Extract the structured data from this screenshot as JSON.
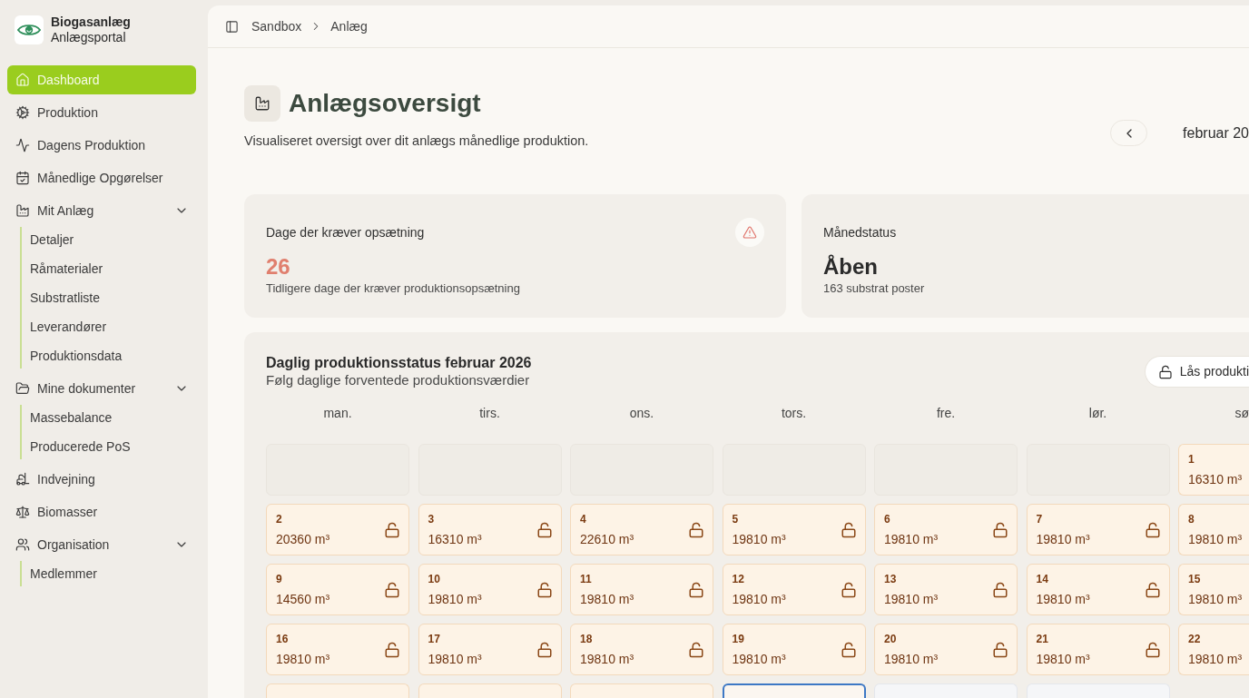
{
  "sidebar": {
    "brand": {
      "title": "Biogasanlæg",
      "subtitle": "Anlægsportal"
    },
    "items": [
      {
        "label": "Dashboard",
        "selected": true
      },
      {
        "label": "Produktion",
        "selected": false
      },
      {
        "label": "Dagens Produktion",
        "selected": false
      },
      {
        "label": "Månedlige Opgørelser",
        "selected": false
      },
      {
        "label": "Mit Anlæg",
        "selected": false,
        "expanded": true,
        "children": [
          {
            "label": "Detaljer",
            "selected": false
          },
          {
            "label": "Råmaterialer",
            "selected": false
          },
          {
            "label": "Substratliste",
            "selected": false
          },
          {
            "label": "Leverandører",
            "selected": false
          },
          {
            "label": "Produktionsdata",
            "selected": false
          }
        ]
      },
      {
        "label": "Mine dokumenter",
        "selected": false,
        "expanded": true,
        "children": [
          {
            "label": "Massebalance",
            "selected": false
          },
          {
            "label": "Producerede PoS",
            "selected": false
          }
        ]
      },
      {
        "label": "Indvejning",
        "selected": false
      },
      {
        "label": "Biomasser",
        "selected": false
      },
      {
        "label": "Organisation",
        "selected": false,
        "expanded": true,
        "children": [
          {
            "label": "Medlemmer",
            "selected": false
          }
        ]
      }
    ]
  },
  "breadcrumb": [
    {
      "label": "Sandbox"
    },
    {
      "label": "Anlæg"
    }
  ],
  "page": {
    "title": "Anlægsoversigt",
    "subtitle": "Visualiseret oversigt over dit anlægs månedlige produktion.",
    "month": "februar 20"
  },
  "stats": [
    {
      "kind": "alert",
      "label": "Dage der kræver opsætning",
      "value": "26",
      "note": "Tidligere dage der kræver produktionsopsætning"
    },
    {
      "kind": "status",
      "label": "Månedstatus",
      "value": "Åben",
      "note": "163 substrat poster"
    }
  ],
  "calendar": {
    "title": "Daglig produktionsstatus februar 2026",
    "subtitle": "Følg daglige forventede produktionsværdier",
    "lock_button": "Lås produkti",
    "weekdays": [
      "man.",
      "tirs.",
      "ons.",
      "tors.",
      "fre.",
      "lør.",
      "sø"
    ],
    "weeks": [
      [
        {
          "kind": "empty"
        },
        {
          "kind": "empty"
        },
        {
          "kind": "empty"
        },
        {
          "kind": "empty"
        },
        {
          "kind": "empty"
        },
        {
          "kind": "empty"
        },
        {
          "kind": "open",
          "day": "1",
          "value": "16310 m³"
        }
      ],
      [
        {
          "kind": "open",
          "day": "2",
          "value": "20360 m³",
          "locked": false
        },
        {
          "kind": "open",
          "day": "3",
          "value": "16310 m³",
          "locked": false
        },
        {
          "kind": "open",
          "day": "4",
          "value": "22610 m³",
          "locked": false
        },
        {
          "kind": "open",
          "day": "5",
          "value": "19810 m³",
          "locked": false
        },
        {
          "kind": "open",
          "day": "6",
          "value": "19810 m³",
          "locked": false
        },
        {
          "kind": "open",
          "day": "7",
          "value": "19810 m³",
          "locked": false
        },
        {
          "kind": "open",
          "day": "8",
          "value": "19810 m³"
        }
      ],
      [
        {
          "kind": "open",
          "day": "9",
          "value": "14560 m³",
          "locked": false
        },
        {
          "kind": "open",
          "day": "10",
          "value": "19810 m³",
          "locked": false
        },
        {
          "kind": "open",
          "day": "11",
          "value": "19810 m³",
          "locked": false
        },
        {
          "kind": "open",
          "day": "12",
          "value": "19810 m³",
          "locked": false
        },
        {
          "kind": "open",
          "day": "13",
          "value": "19810 m³",
          "locked": false
        },
        {
          "kind": "open",
          "day": "14",
          "value": "19810 m³",
          "locked": false
        },
        {
          "kind": "open",
          "day": "15",
          "value": "19810 m³"
        }
      ],
      [
        {
          "kind": "open",
          "day": "16",
          "value": "19810 m³",
          "locked": false
        },
        {
          "kind": "open",
          "day": "17",
          "value": "19810 m³",
          "locked": false
        },
        {
          "kind": "open",
          "day": "18",
          "value": "19810 m³",
          "locked": false
        },
        {
          "kind": "open",
          "day": "19",
          "value": "19810 m³",
          "locked": false
        },
        {
          "kind": "open",
          "day": "20",
          "value": "19810 m³",
          "locked": false
        },
        {
          "kind": "open",
          "day": "21",
          "value": "19810 m³",
          "locked": false
        },
        {
          "kind": "open",
          "day": "22",
          "value": "19810 m³"
        }
      ],
      [
        {
          "kind": "open"
        },
        {
          "kind": "open"
        },
        {
          "kind": "open"
        },
        {
          "kind": "today"
        },
        {
          "kind": "future"
        },
        {
          "kind": "future"
        }
      ]
    ]
  }
}
